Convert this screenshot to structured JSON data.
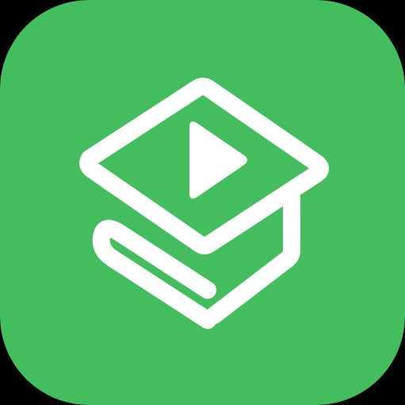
{
  "app_icon": {
    "icon": "graduation-cap-play-book-icon",
    "colors": {
      "background": "#44BD5F",
      "glyph": "#FFFFFF",
      "page_backdrop": "#000000"
    }
  }
}
